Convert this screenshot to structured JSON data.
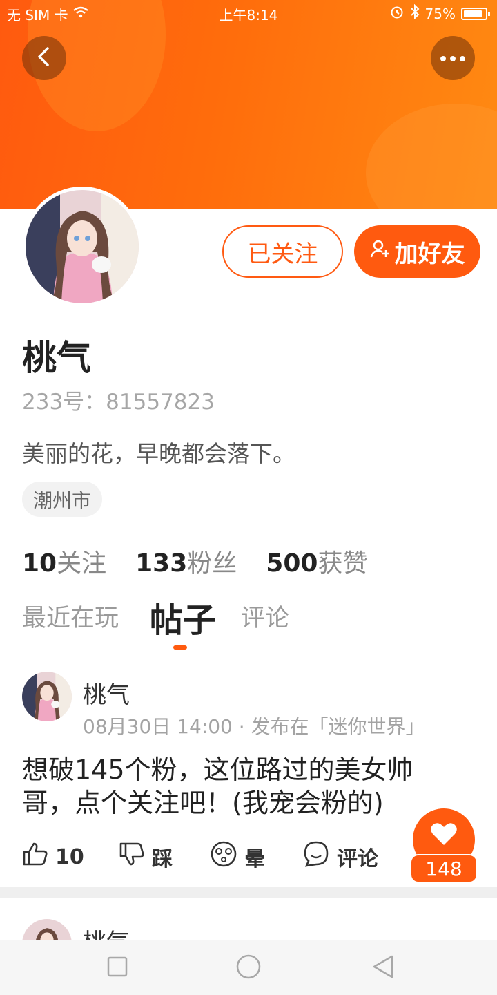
{
  "status_bar": {
    "carrier": "无 SIM 卡",
    "time": "上午8:14",
    "battery": "75%"
  },
  "profile": {
    "name": "桃气",
    "id_text": "233号：81557823",
    "bio": "美丽的花，早晚都会落下。",
    "location": "潮州市",
    "followed_label": "已关注",
    "add_friend_label": "加好友"
  },
  "stats": [
    {
      "value": "10",
      "label": "关注"
    },
    {
      "value": "133",
      "label": "粉丝"
    },
    {
      "value": "500",
      "label": "获赞"
    }
  ],
  "tabs": [
    {
      "label": "最近在玩",
      "active": false
    },
    {
      "label": "帖子",
      "active": true
    },
    {
      "label": "评论",
      "active": false
    }
  ],
  "post": {
    "author": "桃气",
    "meta": "08月30日 14:00 · 发布在「迷你世界」",
    "text": "想破145个粉，这位路过的美女帅哥，点个关注吧！(我宠会粉的)",
    "actions": {
      "like_count": "10",
      "dislike_label": "踩",
      "dizzy_label": "晕",
      "comment_label": "评论"
    },
    "heart_count": "148"
  },
  "post2": {
    "author": "桃气"
  },
  "colors": {
    "accent": "#ff5a0f"
  }
}
